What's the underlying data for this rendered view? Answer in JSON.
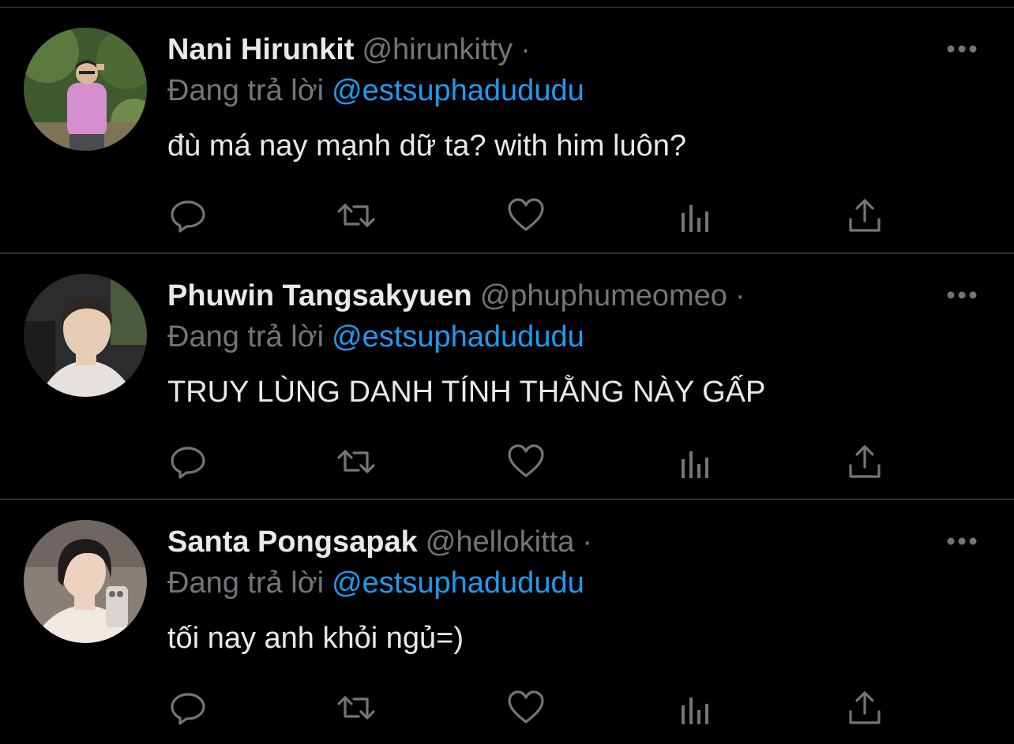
{
  "reply_prefix": "Đang trả lời",
  "tweets": [
    {
      "display_name": "Nani Hirunkit",
      "handle": "@hirunkitty",
      "separator": "·",
      "reply_to": "@estsuphadududu",
      "text": "đù má nay mạnh dữ ta? with him luôn?",
      "avatar_colors": {
        "bg": "#3f5a2e",
        "shirt": "#d58fcf",
        "skin": "#d8b89a"
      }
    },
    {
      "display_name": "Phuwin Tangsakyuen",
      "handle": "@phuphumeomeo",
      "separator": "·",
      "reply_to": "@estsuphadududu",
      "text": "TRUY LÙNG DANH TÍNH THẰNG NÀY GẤP",
      "avatar_colors": {
        "bg": "#2a2c2e",
        "shirt": "#e6e1dc",
        "skin": "#e8cdb6"
      }
    },
    {
      "display_name": "Santa Pongsapak",
      "handle": "@hellokitta",
      "separator": "·",
      "reply_to": "@estsuphadududu",
      "text": "tối nay anh khỏi ngủ=)",
      "avatar_colors": {
        "bg": "#8a7f76",
        "shirt": "#efe9e2",
        "skin": "#ecd2bf"
      }
    }
  ],
  "icons": {
    "reply": "reply-icon",
    "retweet": "retweet-icon",
    "like": "like-icon",
    "views": "views-icon",
    "share": "share-icon",
    "more": "more-icon"
  },
  "colors": {
    "background": "#000000",
    "text": "#e7e9ea",
    "muted": "#71767b",
    "link": "#1d9bf0",
    "divider": "#2f3336"
  }
}
